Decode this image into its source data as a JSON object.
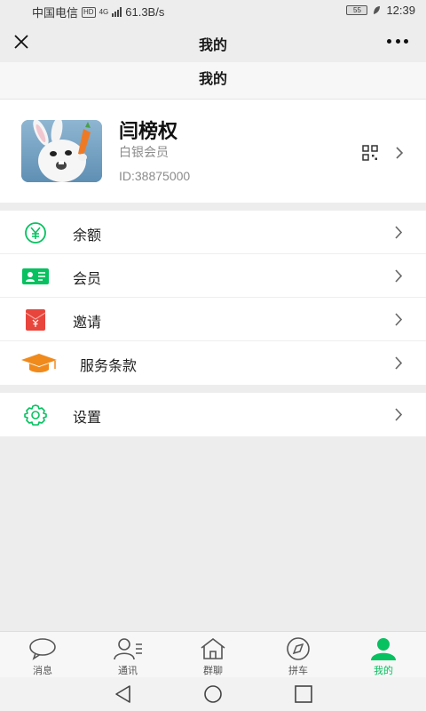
{
  "status_bar": {
    "carrier": "中国电信",
    "hd_badge": "HD",
    "network": "4G",
    "speed": "61.3B/s",
    "battery": "55",
    "time": "12:39"
  },
  "window": {
    "title": "我的"
  },
  "page_header": {
    "title": "我的"
  },
  "profile": {
    "name": "闫榜权",
    "level": "白银会员",
    "id": "ID:38875000"
  },
  "menu": {
    "group1": [
      {
        "label": "余额",
        "icon": "yen-circle-icon"
      },
      {
        "label": "会员",
        "icon": "member-card-icon"
      },
      {
        "label": "邀请",
        "icon": "red-envelope-icon"
      },
      {
        "label": "服务条款",
        "icon": "graduation-cap-icon"
      }
    ],
    "group2": [
      {
        "label": "设置",
        "icon": "gear-icon"
      }
    ]
  },
  "tabs": [
    {
      "label": "消息",
      "icon": "chat-bubble-icon"
    },
    {
      "label": "通讯",
      "icon": "contacts-icon"
    },
    {
      "label": "群聊",
      "icon": "home-icon"
    },
    {
      "label": "拼车",
      "icon": "compass-icon"
    },
    {
      "label": "我的",
      "icon": "person-icon",
      "active": true
    }
  ],
  "colors": {
    "accent": "#07c160",
    "red": "#e8453c",
    "orange": "#f08a1c",
    "background": "#ededed"
  }
}
